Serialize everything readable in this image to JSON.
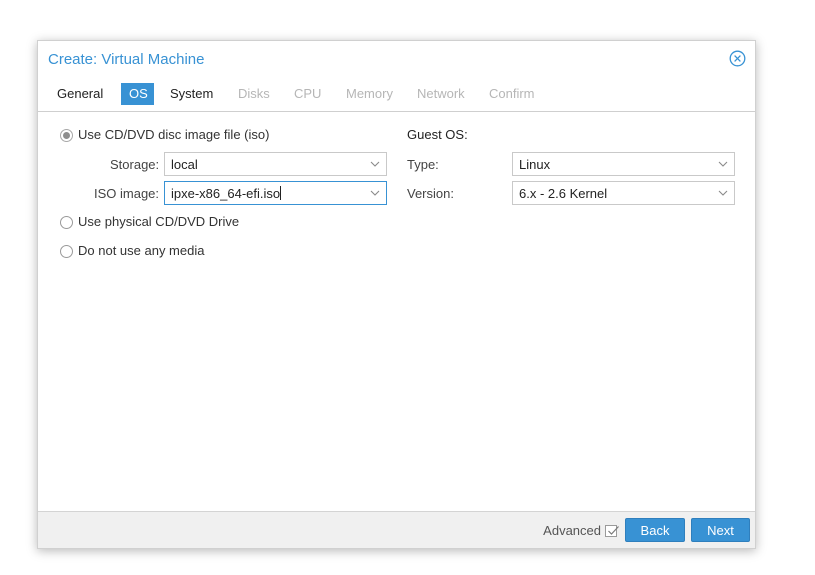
{
  "dialog": {
    "title": "Create: Virtual Machine",
    "close_icon": "close-circle-icon"
  },
  "tabs": [
    {
      "label": "General",
      "state": "enabled"
    },
    {
      "label": "OS",
      "state": "active"
    },
    {
      "label": "System",
      "state": "enabled"
    },
    {
      "label": "Disks",
      "state": "disabled"
    },
    {
      "label": "CPU",
      "state": "disabled"
    },
    {
      "label": "Memory",
      "state": "disabled"
    },
    {
      "label": "Network",
      "state": "disabled"
    },
    {
      "label": "Confirm",
      "state": "disabled"
    }
  ],
  "media": {
    "option_iso": "Use CD/DVD disc image file (iso)",
    "option_iso_selected": true,
    "storage_label": "Storage:",
    "storage_value": "local",
    "iso_label": "ISO image:",
    "iso_value": "ipxe-x86_64-efi.iso",
    "option_physical": "Use physical CD/DVD Drive",
    "option_none": "Do not use any media"
  },
  "guest_os": {
    "heading": "Guest OS:",
    "type_label": "Type:",
    "type_value": "Linux",
    "version_label": "Version:",
    "version_value": "6.x - 2.6 Kernel"
  },
  "footer": {
    "advanced_label": "Advanced",
    "advanced_checked": true,
    "back_label": "Back",
    "next_label": "Next"
  },
  "colors": {
    "accent": "#3892d4",
    "disabled_tab": "#b6b6b6",
    "footer_bg": "#f0f0f0"
  }
}
